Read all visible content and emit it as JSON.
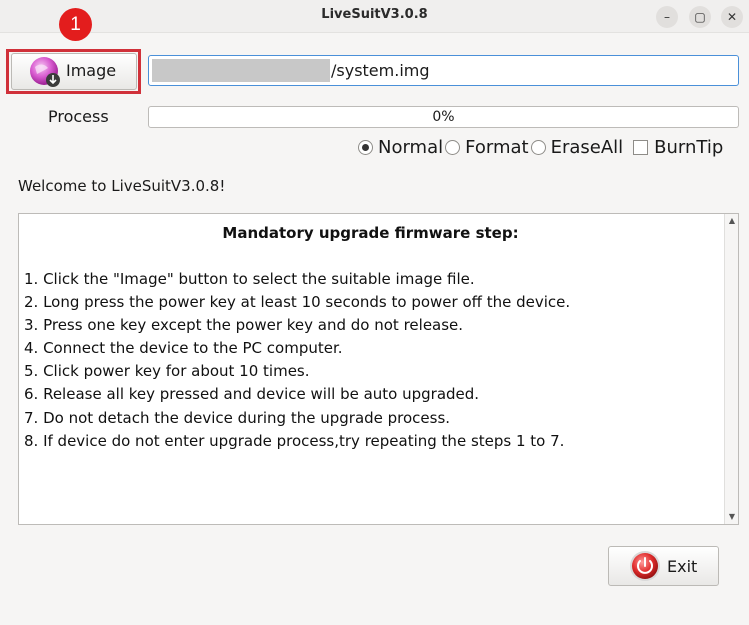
{
  "window": {
    "title": "LiveSuitV3.0.8",
    "minimize_glyph": "–",
    "maximize_glyph": "▢",
    "close_glyph": "✕"
  },
  "annotation": {
    "badge_number": "1",
    "highlight_color": "#d0313a",
    "badge_color": "#e31d1d"
  },
  "image_button": {
    "label": "Image",
    "icon": "image-disc-icon"
  },
  "path_field": {
    "value": "/system.img"
  },
  "process": {
    "label": "Process",
    "progress_text": "0%",
    "progress": 0
  },
  "options": {
    "normal": {
      "label": "Normal",
      "selected": true
    },
    "format": {
      "label": "Format",
      "selected": false
    },
    "eraseall": {
      "label": "EraseAll",
      "selected": false
    },
    "burntip": {
      "label": "BurnTip",
      "checked": false
    }
  },
  "welcome": "Welcome to LiveSuitV3.0.8!",
  "instructions": {
    "heading": "Mandatory upgrade firmware step:",
    "steps": [
      "1. Click the \"Image\" button to select the suitable image file.",
      "2. Long press the power key at least 10 seconds to power off the device.",
      "3. Press one key except the power key and do not release.",
      "4. Connect the device to the PC computer.",
      "5. Click power key for about 10 times.",
      "6. Release all key pressed and device will be auto upgraded.",
      "7. Do not detach the device during the upgrade process.",
      "8. If device do not enter upgrade process,try repeating the steps 1 to 7."
    ]
  },
  "exit_button": {
    "label": "Exit",
    "icon": "power-icon"
  },
  "colors": {
    "accent": "#4a90d9",
    "window_bg": "#f6f5f4"
  }
}
